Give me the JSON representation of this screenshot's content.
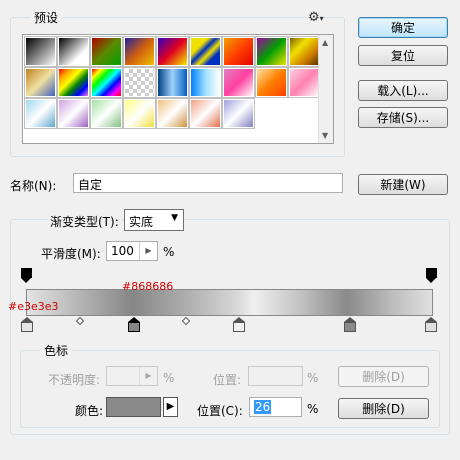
{
  "presets": {
    "legend": "预设",
    "menu_icon": "gear-icon"
  },
  "buttons": {
    "ok": "确定",
    "reset": "复位",
    "load": "载入(L)...",
    "save": "存储(S)...",
    "new": "新建(W)",
    "delete_opacity": "删除(D)",
    "delete_color": "删除(D)"
  },
  "name_field": {
    "label": "名称(N):",
    "value": "自定"
  },
  "gradient": {
    "type_label": "渐变类型(T):",
    "type_value": "实底",
    "smoothness_label": "平滑度(M):",
    "smoothness_value": "100",
    "smoothness_unit": "%",
    "left_color_label": "#e3e3e3",
    "mid_color_label": "#868686"
  },
  "color_stops": {
    "legend": "色标",
    "opacity_label": "不透明度:",
    "opacity_unit": "%",
    "opacity_location_label": "位置:",
    "opacity_location_unit": "%",
    "color_label": "颜色:",
    "color_value": "#8a8a8a",
    "location_label": "位置(C):",
    "location_value": "26",
    "location_unit": "%"
  }
}
